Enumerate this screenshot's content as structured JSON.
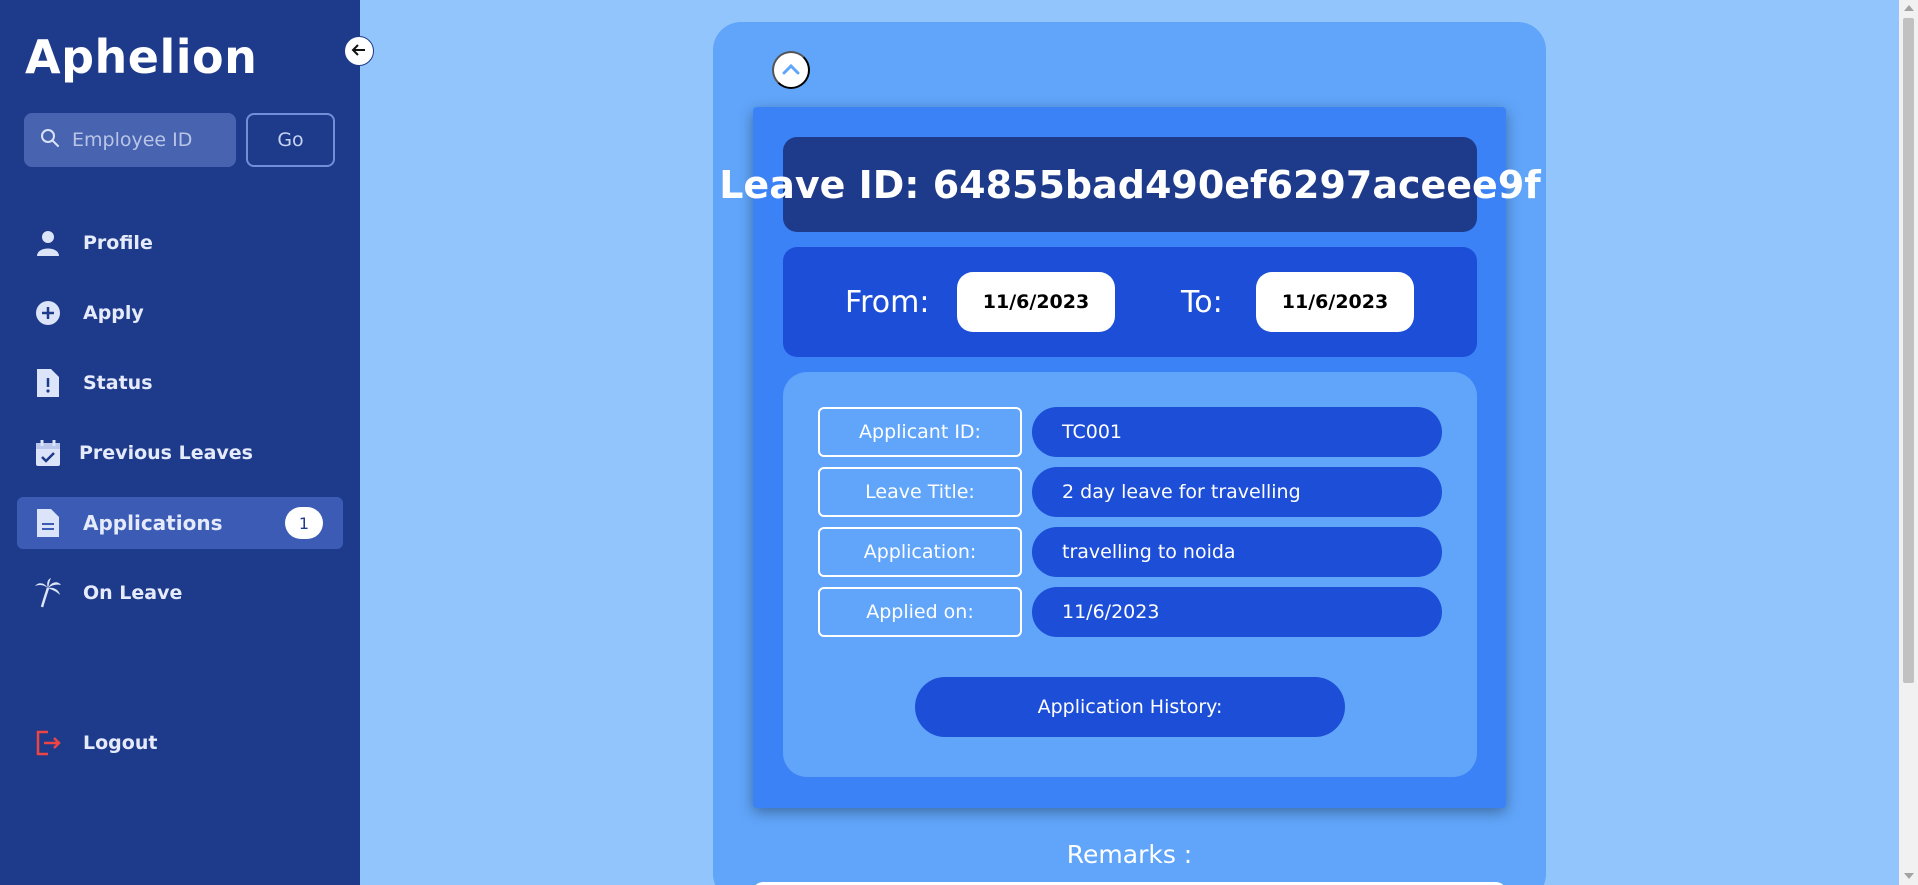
{
  "app": {
    "brand": "Aphelion"
  },
  "search": {
    "placeholder": "Employee ID",
    "go_label": "Go"
  },
  "nav": {
    "profile": "Profile",
    "apply": "Apply",
    "status": "Status",
    "previous_leaves": "Previous Leaves",
    "applications": "Applications",
    "applications_badge": "1",
    "on_leave": "On Leave",
    "logout": "Logout"
  },
  "leave": {
    "id_text": "Leave ID: 64855bad490ef6297aceee9f",
    "from_label": "From:",
    "from_date": "11/6/2023",
    "to_label": "To:",
    "to_date": "11/6/2023",
    "fields": [
      {
        "label": "Applicant ID:",
        "value": "TC001"
      },
      {
        "label": "Leave Title:",
        "value": "2 day leave for travelling"
      },
      {
        "label": "Application:",
        "value": "travelling to noida"
      },
      {
        "label": "Applied on:",
        "value": "11/6/2023"
      }
    ],
    "history_label": "Application History:",
    "remarks_label": "Remarks :"
  },
  "colors": {
    "sidebar": "#1e3a8a",
    "page_bg": "#93c5fd",
    "card": "#60a5fa",
    "accent": "#1d4ed8",
    "logout_icon": "#ef4444"
  }
}
